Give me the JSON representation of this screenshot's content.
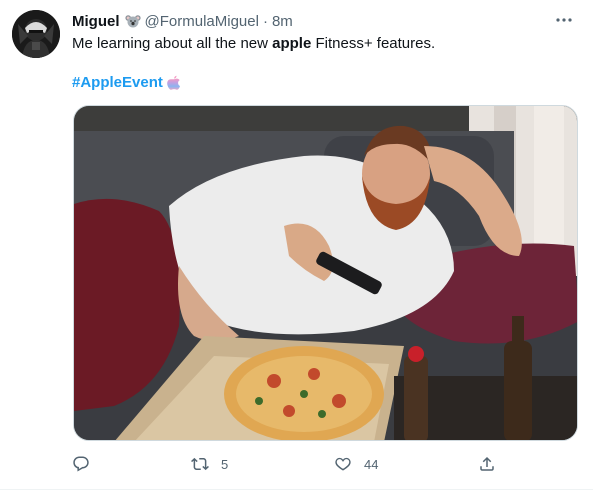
{
  "tweet": {
    "display_name": "Miguel",
    "name_emoji": "koala-icon",
    "handle": "@FormulaMiguel",
    "separator": "·",
    "time": "8m",
    "text_before": "Me learning about all the new ",
    "text_bold": "apple",
    "text_after": " Fitness+ features.",
    "hashtag": "#AppleEvent",
    "hashflag_icon": "apple-rainbow-icon"
  },
  "actions": {
    "reply_icon": "reply-icon",
    "retweet_icon": "retweet-icon",
    "retweet_count": "5",
    "like_icon": "heart-icon",
    "like_count": "44",
    "share_icon": "share-icon"
  },
  "colors": {
    "link": "#1d9bf0",
    "secondary_text": "#536471",
    "border": "#cfd9de"
  }
}
